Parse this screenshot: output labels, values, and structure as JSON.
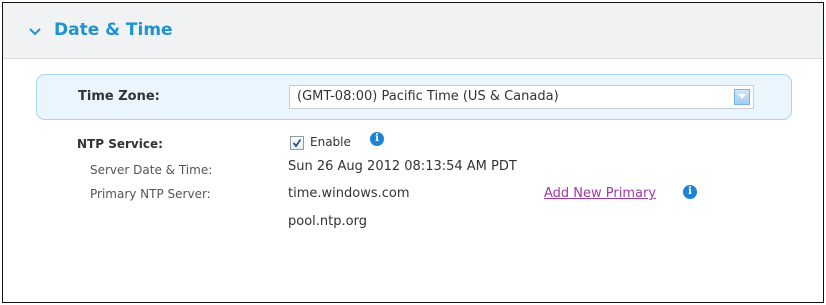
{
  "section": {
    "title": "Date & Time",
    "accent_color": "#1d94cf"
  },
  "time_zone": {
    "label": "Time Zone:",
    "selected": "(GMT-08:00) Pacific Time (US & Canada)"
  },
  "ntp": {
    "label": "NTP Service:",
    "enabled": true,
    "enable_label": "Enable",
    "server_datetime_label": "Server Date & Time:",
    "server_datetime_value": "Sun 26 Aug 2012 08:13:54 AM PDT",
    "primary_server_label": "Primary NTP Server:",
    "primary_servers": [
      "time.windows.com",
      "pool.ntp.org"
    ],
    "add_primary_link": "Add New Primary",
    "link_color": "#a03aa6"
  },
  "icons": {
    "collapse": "chevron-down-icon",
    "info": "info-icon",
    "dropdown": "dropdown-arrow-icon",
    "check": "checkmark-icon"
  }
}
